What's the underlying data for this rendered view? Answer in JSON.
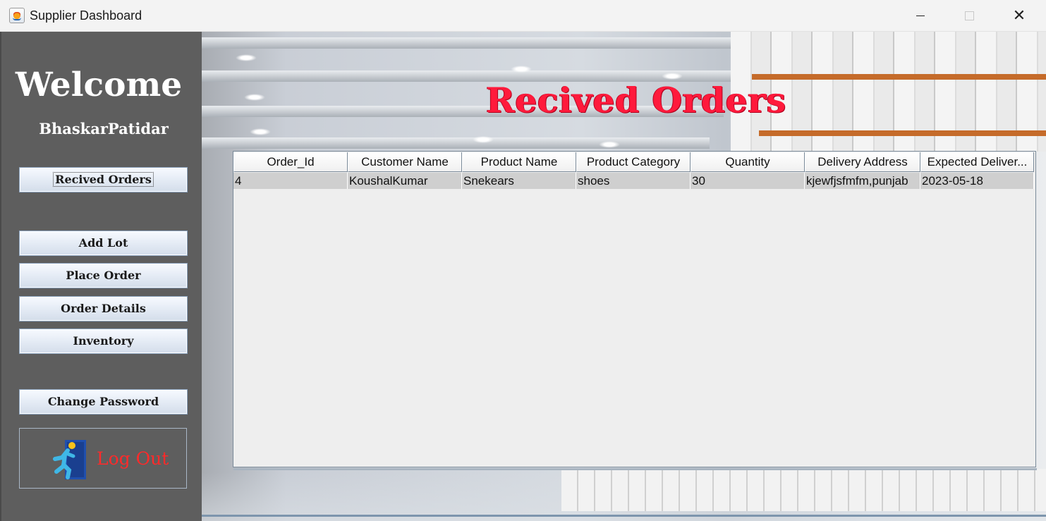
{
  "window": {
    "title": "Supplier Dashboard",
    "app_icon": "java-cup-icon",
    "controls": {
      "minimize": "minimize-icon",
      "maximize": "maximize-icon",
      "close": "✕"
    }
  },
  "sidebar": {
    "welcome": "Welcome",
    "username": "BhaskarPatidar",
    "buttons": [
      {
        "label": "Recived Orders"
      },
      {
        "label": "Add Lot"
      },
      {
        "label": "Place Order"
      },
      {
        "label": "Order Details"
      },
      {
        "label": "Inventory"
      },
      {
        "label": "Change Password"
      }
    ],
    "logout": {
      "label": "Log Out",
      "icon": "exit-door-icon"
    }
  },
  "main": {
    "title": "Recived Orders",
    "table": {
      "columns": [
        "Order_Id",
        "Customer Name",
        "Product Name",
        "Product Category",
        "Quantity",
        "Delivery Address",
        "Expected Deliver..."
      ],
      "rows": [
        [
          "4",
          "KoushalKumar",
          "Snekears",
          "shoes",
          "30",
          "kjewfjsfmfm,punjab",
          "2023-05-18"
        ]
      ]
    }
  },
  "colors": {
    "sidebar_bg": "#5e5e5e",
    "title_red": "#ff1a3c",
    "logout_red": "#ff2a2a",
    "selected_row": "#cfcfcf"
  }
}
